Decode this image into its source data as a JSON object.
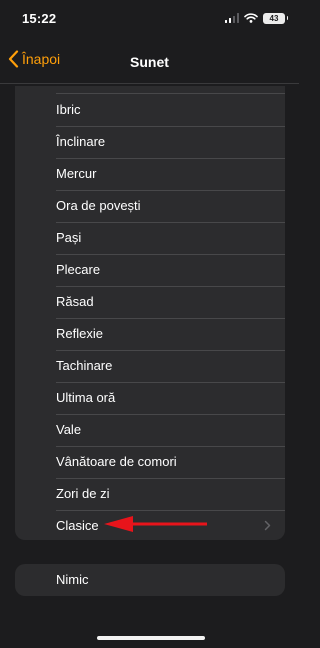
{
  "status_bar": {
    "time": "15:22",
    "battery": "43",
    "icons": [
      "cellular-signal-icon",
      "wifi-icon",
      "battery-icon"
    ]
  },
  "nav": {
    "back_label": "Înapoi",
    "title": "Sunet"
  },
  "colors": {
    "accent": "#ff9f0a",
    "background": "#1c1c1e",
    "group_background": "#2c2c2e",
    "annotation_arrow": "#e8141b"
  },
  "sounds": [
    {
      "label": "Ibric"
    },
    {
      "label": "Înclinare"
    },
    {
      "label": "Mercur"
    },
    {
      "label": "Ora de povești"
    },
    {
      "label": "Pași"
    },
    {
      "label": "Plecare"
    },
    {
      "label": "Răsad"
    },
    {
      "label": "Reflexie"
    },
    {
      "label": "Tachinare"
    },
    {
      "label": "Ultima oră"
    },
    {
      "label": "Vale"
    },
    {
      "label": "Vânătoare de comori"
    },
    {
      "label": "Zori de zi"
    }
  ],
  "classics": {
    "label": "Clasice",
    "icon": "chevron-right-icon"
  },
  "none_option": {
    "label": "Nimic"
  }
}
